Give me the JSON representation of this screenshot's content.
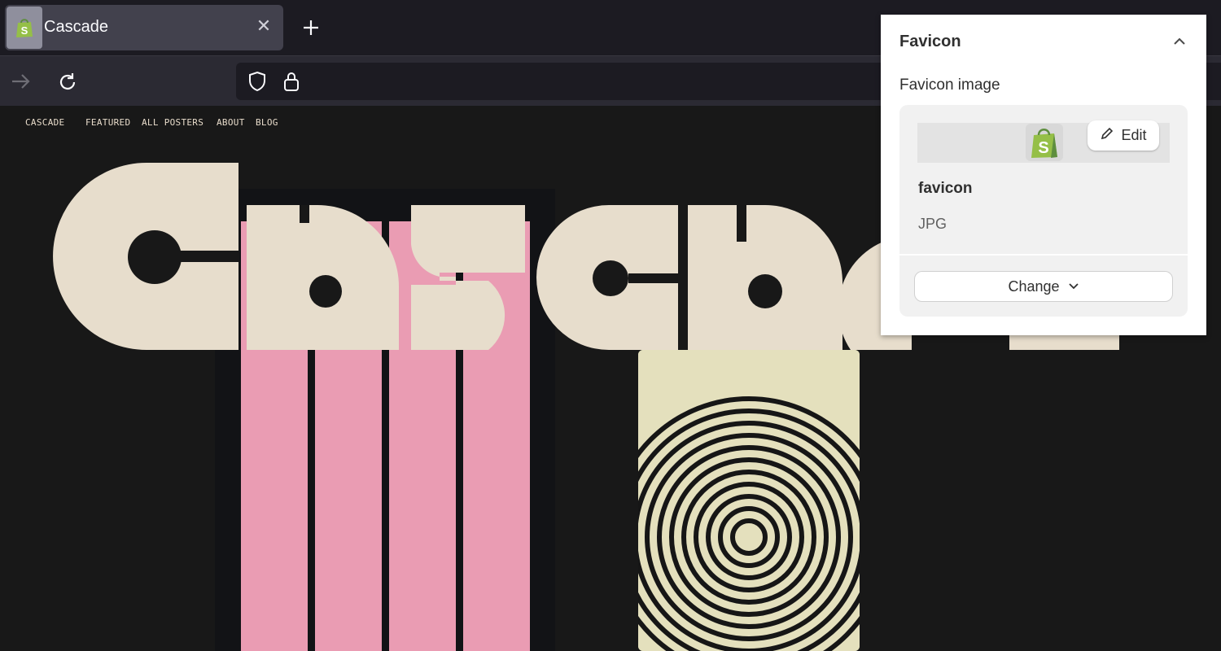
{
  "browser": {
    "tab": {
      "title": "Cascade"
    }
  },
  "site": {
    "nav": [
      "CASCADE",
      "FEATURED",
      "ALL POSTERS",
      "ABOUT",
      "BLOG"
    ],
    "hero_word": "Cascade"
  },
  "panel": {
    "title": "Favicon",
    "field_label": "Favicon image",
    "edit_label": "Edit",
    "file_name": "favicon",
    "file_type": "JPG",
    "change_label": "Change"
  },
  "colors": {
    "accent_green": "#95bf47",
    "hero_cream": "#e7ddcc",
    "poster_pink": "#ea9cb3"
  }
}
